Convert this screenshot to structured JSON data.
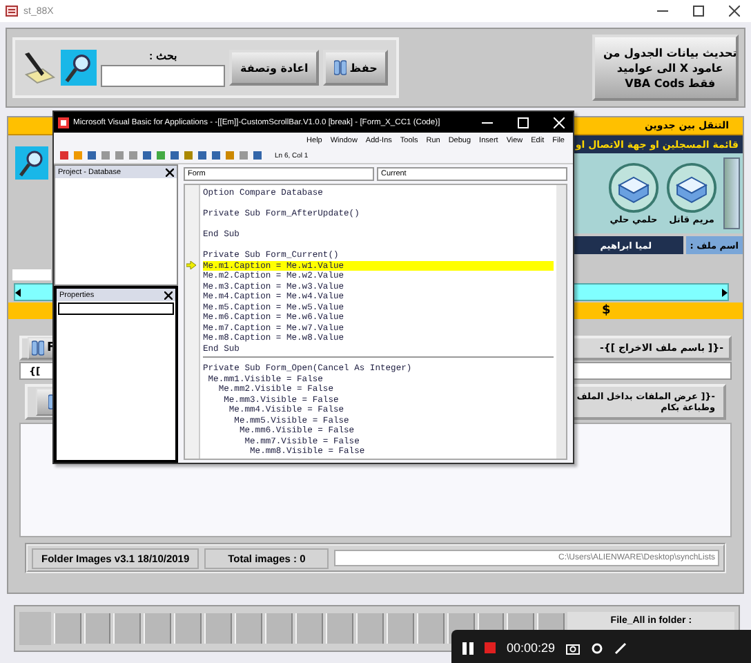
{
  "window": {
    "title": "st_88X"
  },
  "toolbar": {
    "search_label": "بحث :",
    "buttons": [
      {
        "label": "حفظ"
      },
      {
        "label": "اعادة وتصفة"
      }
    ],
    "update_button": {
      "lines": [
        "تحديث بيانات الجدول من",
        "عامود X الى عواميد",
        "فقط VBA Cods"
      ]
    }
  },
  "navigation": {
    "header": "التنقل بين جدوين",
    "list_title": "قائمة المسجلين او جهة الاتصال او",
    "contacts": [
      {
        "name": "مريم قاتل"
      },
      {
        "name": "حلمي حلي"
      }
    ],
    "file_label": "اسم ملف :",
    "file_value": "لميا ابراهيم",
    "currency": "$"
  },
  "output_panel": {
    "title": "-{[ باسم ملف الاخراج ]}-",
    "button": "F",
    "dropdown": "{["
  },
  "files_panel": {
    "title": "-{[ عرض الملفات بداخل الملف وطباعة بكام"
  },
  "status_bar": {
    "version": "Folder Images v3.1  18/10/2019",
    "total": "Total images : 0",
    "path": "C:\\Users\\ALIENWARE\\Desktop\\synchLists"
  },
  "footer": {
    "label": "File_All in folder :"
  },
  "recorder": {
    "time": "00:00:29"
  },
  "vba": {
    "title": "Microsoft Visual Basic for Applications - -[[Em]]-CustomScrollBar.V1.0.0 [break] - [Form_X_CC1 (Code)]",
    "menu": [
      "Help",
      "Window",
      "Add-Ins",
      "Tools",
      "Run",
      "Debug",
      "Insert",
      "View",
      "Edit",
      "File"
    ],
    "position": "Ln 6, Col 1",
    "project_title": "Project - Database",
    "properties_title": "Properties",
    "object": "Form",
    "procedure": "Current",
    "procedures": [
      {
        "lines": [
          {
            "kind": "code",
            "text": "Option Compare Database",
            "highlighted": false
          },
          {
            "kind": "blank",
            "highlighted": false
          },
          {
            "kind": "code",
            "text": "Private Sub Form_AfterUpdate()",
            "highlighted": false
          },
          {
            "kind": "blank",
            "highlighted": false
          },
          {
            "kind": "code",
            "text": "End Sub",
            "highlighted": false
          },
          {
            "kind": "blank",
            "highlighted": false
          },
          {
            "kind": "code",
            "text": "Private Sub Form_Current()",
            "highlighted": false
          },
          {
            "kind": "code",
            "text": "Me.m1.Caption = Me.w1.Value",
            "highlighted": true
          },
          {
            "kind": "code",
            "text": "Me.m2.Caption = Me.w2.Value",
            "highlighted": false
          },
          {
            "kind": "code",
            "text": "Me.m3.Caption = Me.w3.Value",
            "highlighted": false
          },
          {
            "kind": "code",
            "text": "Me.m4.Caption = Me.w4.Value",
            "highlighted": false
          },
          {
            "kind": "code",
            "text": "Me.m5.Caption = Me.w5.Value",
            "highlighted": false
          },
          {
            "kind": "code",
            "text": "Me.m6.Caption = Me.w6.Value",
            "highlighted": false
          },
          {
            "kind": "code",
            "text": "Me.m7.Caption = Me.w7.Value",
            "highlighted": false
          },
          {
            "kind": "code",
            "text": "Me.m8.Caption = Me.w8.Value",
            "highlighted": false
          },
          {
            "kind": "code",
            "text": "End Sub",
            "highlighted": false
          }
        ]
      },
      {
        "lines": [
          {
            "kind": "code",
            "text": "Private Sub Form_Open(Cancel As Integer)",
            "highlighted": false
          },
          {
            "kind": "code",
            "text": " Me.mm1.Visible = False",
            "highlighted": false
          },
          {
            "kind": "code",
            "text": "   Me.mm2.Visible = False",
            "highlighted": false
          },
          {
            "kind": "code",
            "text": "    Me.mm3.Visible = False",
            "highlighted": false
          },
          {
            "kind": "code",
            "text": "     Me.mm4.Visible = False",
            "highlighted": false
          },
          {
            "kind": "code",
            "text": "      Me.mm5.Visible = False",
            "highlighted": false
          },
          {
            "kind": "code",
            "text": "       Me.mm6.Visible = False",
            "highlighted": false
          },
          {
            "kind": "code",
            "text": "        Me.mm7.Visible = False",
            "highlighted": false
          },
          {
            "kind": "code",
            "text": "         Me.mm8.Visible = False",
            "highlighted": false
          }
        ]
      }
    ]
  }
}
